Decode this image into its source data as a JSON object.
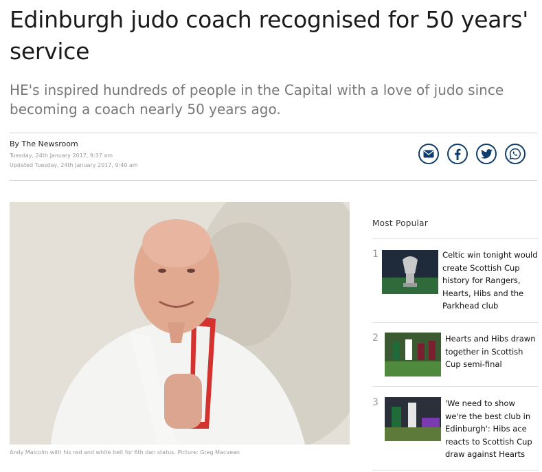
{
  "article": {
    "headline": "Edinburgh judo coach recognised for 50 years' service",
    "standfirst": "HE's inspired hundreds of people in the Capital with a love of judo since becoming a coach nearly 50 years ago.",
    "byline": "By The Newsroom",
    "published": "Tuesday, 24th January 2017, 9:37 am",
    "updated": "Updated  Tuesday, 24th January 2017, 9:40 am",
    "caption": "Andy Malcolm with his red and white belt for 6th dan status. Picture: Greg Macvean"
  },
  "share": {
    "buttons": [
      {
        "icon": "envelope-icon",
        "label": "email"
      },
      {
        "icon": "facebook-icon",
        "label": "facebook"
      },
      {
        "icon": "twitter-icon",
        "label": "twitter"
      },
      {
        "icon": "whatsapp-icon",
        "label": "whatsapp"
      }
    ],
    "color": "#0e3d6b"
  },
  "most_popular": {
    "title": "Most Popular",
    "items": [
      {
        "rank": "1",
        "title": "Celtic win tonight would create Scottish Cup history for Rangers, Hearts, Hibs and the Parkhead club"
      },
      {
        "rank": "2",
        "title": "Hearts and Hibs drawn together in Scottish Cup semi-final"
      },
      {
        "rank": "3",
        "title": "'We need to show we're the best club in Edinburgh': Hibs ace reacts to Scottish Cup draw against Hearts"
      }
    ]
  }
}
